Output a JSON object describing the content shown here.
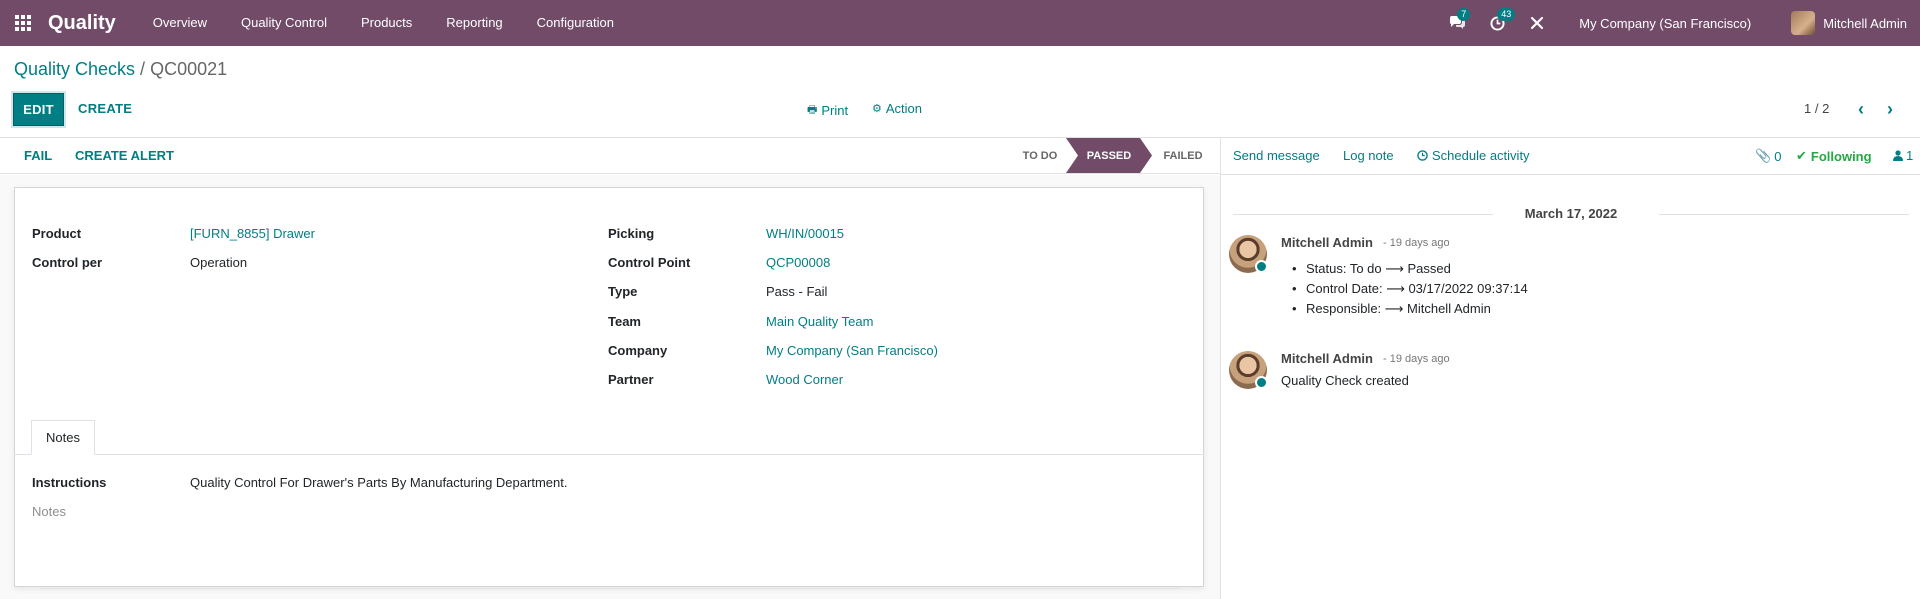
{
  "navbar": {
    "app_name": "Quality",
    "menu": [
      "Overview",
      "Quality Control",
      "Products",
      "Reporting",
      "Configuration"
    ],
    "messages_count": "7",
    "activities_count": "43",
    "company": "My Company (San Francisco)",
    "user": "Mitchell Admin",
    "icons": {
      "apps": "apps-grid-icon",
      "messages": "chat-bubbles-icon",
      "activities": "clock-icon",
      "debug": "wrench-icon"
    }
  },
  "breadcrumb": {
    "parent": "Quality Checks",
    "separator": " / ",
    "current": "QC00021"
  },
  "buttons": {
    "edit": "EDIT",
    "create": "CREATE",
    "print": "Print",
    "action": "Action"
  },
  "pager": {
    "value": "1 / 2"
  },
  "statusbar": {
    "fail": "FAIL",
    "create_alert": "CREATE ALERT",
    "stages": [
      "TO DO",
      "PASSED",
      "FAILED"
    ],
    "active_stage": "PASSED",
    "active_color": "#714B67"
  },
  "form": {
    "left": [
      {
        "label": "Product",
        "value": "[FURN_8855] Drawer",
        "link": true
      },
      {
        "label": "Control per",
        "value": "Operation",
        "link": false
      }
    ],
    "right": [
      {
        "label": "Picking",
        "value": "WH/IN/00015",
        "link": true
      },
      {
        "label": "Control Point",
        "value": "QCP00008",
        "link": true
      },
      {
        "label": "Type",
        "value": "Pass - Fail",
        "link": false
      },
      {
        "label": "Team",
        "value": "Main Quality Team",
        "link": true
      },
      {
        "label": "Company",
        "value": "My Company (San Francisco)",
        "link": true
      },
      {
        "label": "Partner",
        "value": "Wood Corner",
        "link": true
      }
    ],
    "tab": "Notes",
    "instructions_label": "Instructions",
    "instructions_value": "Quality Control For Drawer's Parts By Manufacturing Department.",
    "notes_placeholder": "Notes"
  },
  "chatter": {
    "send_message": "Send message",
    "log_note": "Log note",
    "schedule_activity": "Schedule activity",
    "attachments": "0",
    "following": "Following",
    "followers": "1",
    "date_separator": "March 17, 2022",
    "messages": [
      {
        "author": "Mitchell Admin",
        "date": "- 19 days ago",
        "tracking": [
          "Status: To do ⟶ Passed",
          "Control Date: ⟶ 03/17/2022 09:37:14",
          "Responsible: ⟶ Mitchell Admin"
        ]
      },
      {
        "author": "Mitchell Admin",
        "date": "- 19 days ago",
        "body": "Quality Check created"
      }
    ]
  },
  "colors": {
    "brand": "#714B67",
    "accent": "#017e84",
    "following": "#28a745"
  }
}
